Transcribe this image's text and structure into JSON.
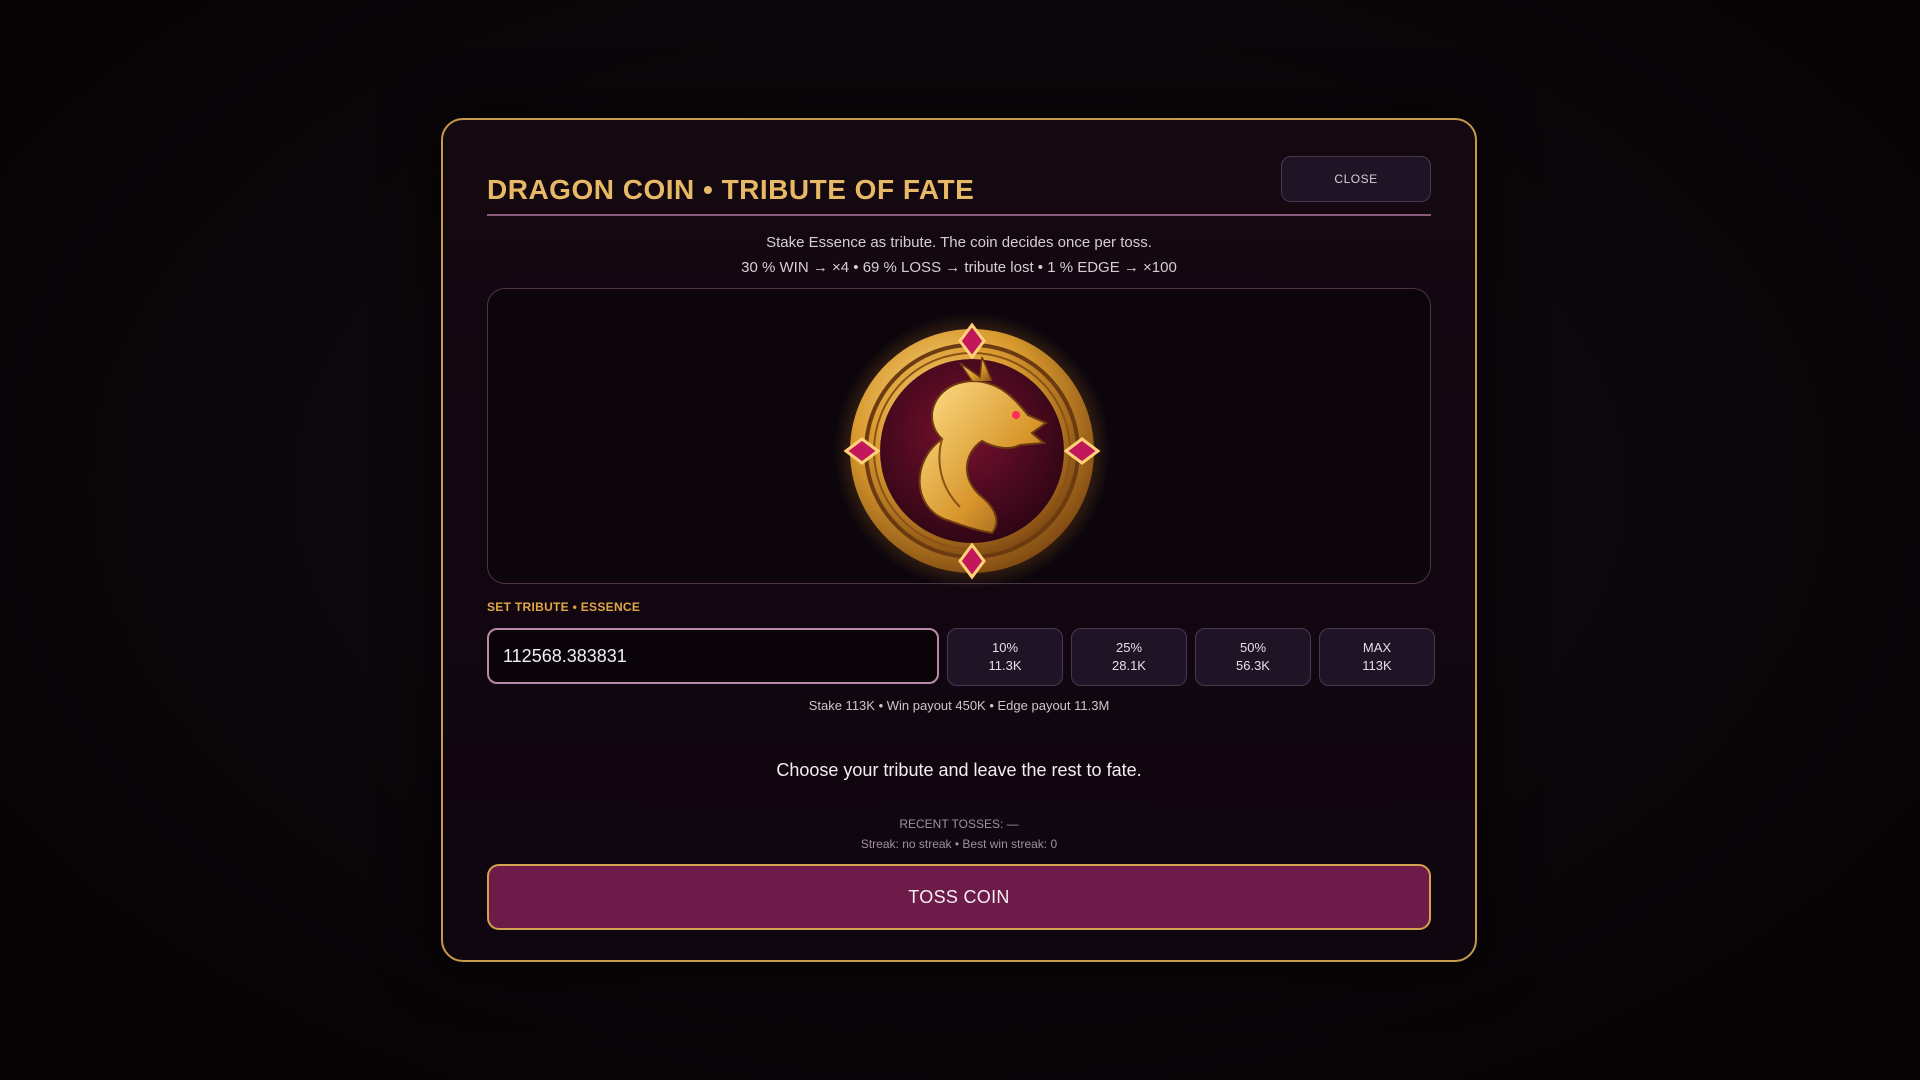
{
  "modal": {
    "title": "DRAGON COIN • TRIBUTE OF FATE",
    "close_label": "CLOSE"
  },
  "description": {
    "line1": "Stake Essence as tribute. The coin decides once per toss.",
    "line2": "30 % WIN → ×4  •  69 % LOSS → tribute lost  •  1 % EDGE → ×100"
  },
  "coin": {
    "icon": "dragon-coin-icon"
  },
  "tribute": {
    "label": "SET TRIBUTE • ESSENCE",
    "amount": "112568.383831",
    "presets": [
      {
        "pct": "10%",
        "value": "11.3K"
      },
      {
        "pct": "25%",
        "value": "28.1K"
      },
      {
        "pct": "50%",
        "value": "56.3K"
      },
      {
        "pct": "MAX",
        "value": "113K"
      }
    ],
    "summary": "Stake 113K • Win payout 450K • Edge payout 11.3M"
  },
  "message": "Choose your tribute and leave the rest to fate.",
  "history": {
    "recent": "RECENT TOSSES: —",
    "streak": "Streak: no streak • Best win streak: 0"
  },
  "toss_label": "TOSS COIN",
  "colors": {
    "accent_gold": "#e7b866",
    "frame_gold": "#c79a4a",
    "toss_button": "#6d1c49",
    "gem_red": "#c2185b"
  }
}
